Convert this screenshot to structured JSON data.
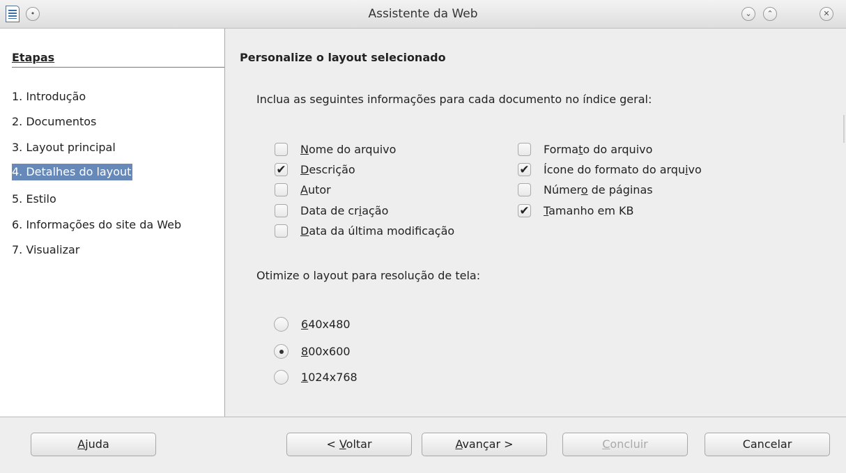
{
  "window": {
    "title": "Assistente da Web"
  },
  "sidebar": {
    "title": "Etapas",
    "steps": [
      {
        "label": "1. Introdução"
      },
      {
        "label": "2. Documentos"
      },
      {
        "label": "3. Layout principal"
      },
      {
        "label": "4. Detalhes do layout",
        "active": true
      },
      {
        "label": "5. Estilo"
      },
      {
        "label": "6. Informações do site da Web"
      },
      {
        "label": "7. Visualizar"
      }
    ]
  },
  "main": {
    "heading": "Personalize o layout selecionado",
    "include_label": "Inclua as seguintes informações para cada documento no índice geral:",
    "checkboxes": {
      "filename": {
        "pre": "",
        "u": "N",
        "post": "ome do arquivo",
        "checked": false
      },
      "description": {
        "pre": "",
        "u": "D",
        "post": "escrição",
        "checked": true
      },
      "author": {
        "pre": "",
        "u": "A",
        "post": "utor",
        "checked": false
      },
      "creation": {
        "pre": "Data de cr",
        "u": "i",
        "post": "ação",
        "checked": false
      },
      "modified": {
        "pre": "",
        "u": "D",
        "post": "ata da última modificação",
        "checked": false
      },
      "format": {
        "pre": "Forma",
        "u": "t",
        "post": "o do arquivo",
        "checked": false
      },
      "format_icon": {
        "pre": "Ícone do formato do arqu",
        "u": "i",
        "post": "vo",
        "checked": true
      },
      "pages": {
        "pre": "Númer",
        "u": "o",
        "post": " de páginas",
        "checked": false
      },
      "size": {
        "pre": "",
        "u": "T",
        "post": "amanho em KB",
        "checked": true
      }
    },
    "resolution_label": "Otimize o layout para resolução de tela:",
    "resolutions": {
      "r640": {
        "u": "6",
        "post": "40x480",
        "selected": false
      },
      "r800": {
        "u": "8",
        "post": "00x600",
        "selected": true
      },
      "r1024": {
        "u": "1",
        "post": "024x768",
        "selected": false
      }
    }
  },
  "buttons": {
    "help": {
      "pre": "",
      "u": "A",
      "post": "juda"
    },
    "back": {
      "pre": "< ",
      "u": "V",
      "post": "oltar"
    },
    "next": {
      "pre": "",
      "u": "A",
      "post": "vançar >"
    },
    "finish": {
      "pre": "",
      "u": "C",
      "post": "oncluir",
      "disabled": true
    },
    "cancel": {
      "pre": "",
      "u": "",
      "post": "Cancelar"
    }
  },
  "icons": {
    "checkmark": "✔",
    "minimize": "⌄",
    "maximize": "⌃",
    "close": "✕"
  }
}
